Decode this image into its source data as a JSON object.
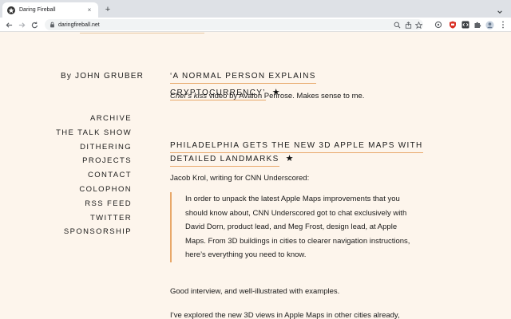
{
  "browser": {
    "tab_title": "Daring Fireball",
    "tab_close": "×",
    "new_tab": "+",
    "url": "daringfireball.net"
  },
  "sidebar": {
    "byline": "By JOHN GRUBER",
    "items": [
      {
        "label": "ARCHIVE"
      },
      {
        "label": "THE TALK SHOW"
      },
      {
        "label": "DITHERING"
      },
      {
        "label": "PROJECTS"
      },
      {
        "label": "CONTACT"
      },
      {
        "label": "COLOPHON"
      },
      {
        "label": "RSS FEED"
      },
      {
        "label": "TWITTER"
      },
      {
        "label": "SPONSORSHIP"
      }
    ]
  },
  "posts": [
    {
      "title": "‘A NORMAL PERSON EXPLAINS CRYPTOCURRENCY’",
      "star": "★",
      "body_em": "Chef’s kiss",
      "body_rest": " video by Avalon Penrose. Makes sense to me."
    },
    {
      "title_line1": "PHILADELPHIA GETS THE NEW 3D APPLE MAPS WITH",
      "title_line2": "DETAILED LANDMARKS",
      "star": "★",
      "intro": "Jacob Krol, writing for CNN Underscored:",
      "quote": "In order to unpack the latest Apple Maps improvements that you should know about, CNN Underscored got to chat exclusively with David Dorn, product lead, and Meg Frost, design lead, at Apple Maps. From 3D buildings in cities to clearer navigation instructions, here’s everything you need to know.",
      "after_quote": "Good interview, and well-illustrated with examples.",
      "last_line": "I’ve explored the new 3D views in Apple Maps in other cities already,"
    }
  ],
  "colors": {
    "page_bg": "#fdf5ec",
    "accent": "#e8a86a",
    "text": "#1a1a1a"
  }
}
